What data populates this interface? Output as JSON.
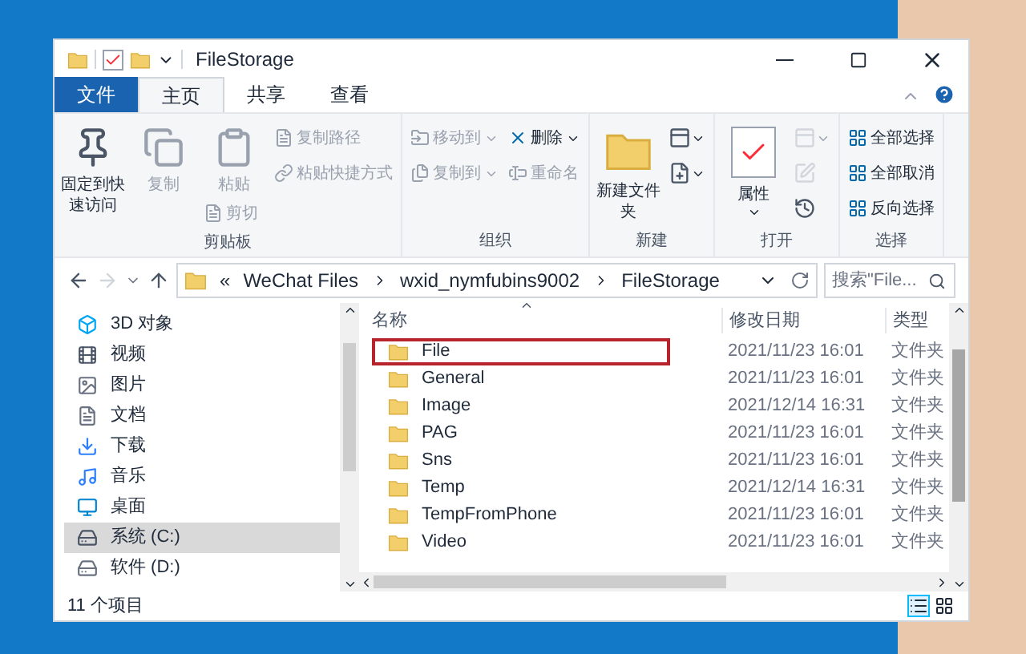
{
  "window": {
    "title": "FileStorage"
  },
  "ribbon_tabs": [
    {
      "label": "文件",
      "kind": "file",
      "selected": false
    },
    {
      "label": "主页",
      "kind": "tab",
      "selected": true
    },
    {
      "label": "共享",
      "kind": "tab",
      "selected": false
    },
    {
      "label": "查看",
      "kind": "tab",
      "selected": false
    }
  ],
  "ribbon_groups": [
    {
      "label": "剪贴板",
      "columns": [
        [
          {
            "kind": "large",
            "label": "固定到快速访问",
            "disabled": false
          }
        ],
        [
          {
            "kind": "large",
            "label": "复制",
            "disabled": true
          }
        ],
        [
          {
            "kind": "large",
            "label": "粘贴",
            "disabled": true
          },
          {
            "kind": "small",
            "label": "剪切",
            "disabled": true
          }
        ],
        [
          {
            "kind": "small",
            "label": "复制路径",
            "disabled": true
          },
          {
            "kind": "small",
            "label": "粘贴快捷方式",
            "disabled": true
          }
        ]
      ]
    },
    {
      "label": "组织",
      "columns": [
        [
          {
            "kind": "small",
            "label": "移动到",
            "disabled": true,
            "dropdown": true
          },
          {
            "kind": "small",
            "label": "复制到",
            "disabled": true,
            "dropdown": true
          }
        ],
        [
          {
            "kind": "small",
            "label": "删除",
            "disabled": false,
            "dropdown": true
          },
          {
            "kind": "small",
            "label": "重命名",
            "disabled": true
          }
        ]
      ]
    },
    {
      "label": "新建",
      "columns": [
        [
          {
            "kind": "large",
            "label": "新建文件夹",
            "disabled": false
          }
        ],
        [
          {
            "kind": "icon",
            "disabled": false,
            "dropdown": true
          },
          {
            "kind": "icon",
            "disabled": false,
            "dropdown": true
          }
        ]
      ]
    },
    {
      "label": "打开",
      "columns": [
        [
          {
            "kind": "large",
            "label": "属性",
            "disabled": false,
            "dropdown": true
          }
        ],
        [
          {
            "kind": "icon",
            "disabled": true,
            "dropdown": true
          },
          {
            "kind": "icon",
            "disabled": true
          },
          {
            "kind": "icon",
            "disabled": false
          }
        ]
      ]
    },
    {
      "label": "选择",
      "columns": [
        [
          {
            "kind": "small",
            "label": "全部选择",
            "disabled": false
          },
          {
            "kind": "small",
            "label": "全部取消",
            "disabled": false
          },
          {
            "kind": "small",
            "label": "反向选择",
            "disabled": false
          }
        ]
      ]
    }
  ],
  "address": {
    "overflow": "«",
    "crumbs": [
      "WeChat Files",
      "wxid_nymfubins9002",
      "FileStorage"
    ]
  },
  "search": {
    "placeholder": "搜索\"File..."
  },
  "nav_items": [
    {
      "label": "3D 对象",
      "selected": false
    },
    {
      "label": "视频",
      "selected": false
    },
    {
      "label": "图片",
      "selected": false
    },
    {
      "label": "文档",
      "selected": false
    },
    {
      "label": "下载",
      "selected": false
    },
    {
      "label": "音乐",
      "selected": false
    },
    {
      "label": "桌面",
      "selected": false
    },
    {
      "label": "系统 (C:)",
      "selected": true
    },
    {
      "label": "软件 (D:)",
      "selected": false
    }
  ],
  "table": {
    "columns": [
      "名称",
      "修改日期",
      "类型"
    ],
    "rows": [
      {
        "name": "File",
        "date": "2021/11/23 16:01",
        "type": "文件夹",
        "highlighted": true
      },
      {
        "name": "General",
        "date": "2021/11/23 16:01",
        "type": "文件夹",
        "highlighted": false
      },
      {
        "name": "Image",
        "date": "2021/12/14 16:31",
        "type": "文件夹",
        "highlighted": false
      },
      {
        "name": "PAG",
        "date": "2021/11/23 16:01",
        "type": "文件夹",
        "highlighted": false
      },
      {
        "name": "Sns",
        "date": "2021/11/23 16:01",
        "type": "文件夹",
        "highlighted": false
      },
      {
        "name": "Temp",
        "date": "2021/12/14 16:31",
        "type": "文件夹",
        "highlighted": false
      },
      {
        "name": "TempFromPhone",
        "date": "2021/11/23 16:01",
        "type": "文件夹",
        "highlighted": false
      },
      {
        "name": "Video",
        "date": "2021/11/23 16:01",
        "type": "文件夹",
        "highlighted": false
      }
    ]
  },
  "status_bar": {
    "count": "11 个项目",
    "view_buttons": [
      {
        "kind": "details",
        "selected": true
      },
      {
        "kind": "icons",
        "selected": false
      }
    ]
  }
}
